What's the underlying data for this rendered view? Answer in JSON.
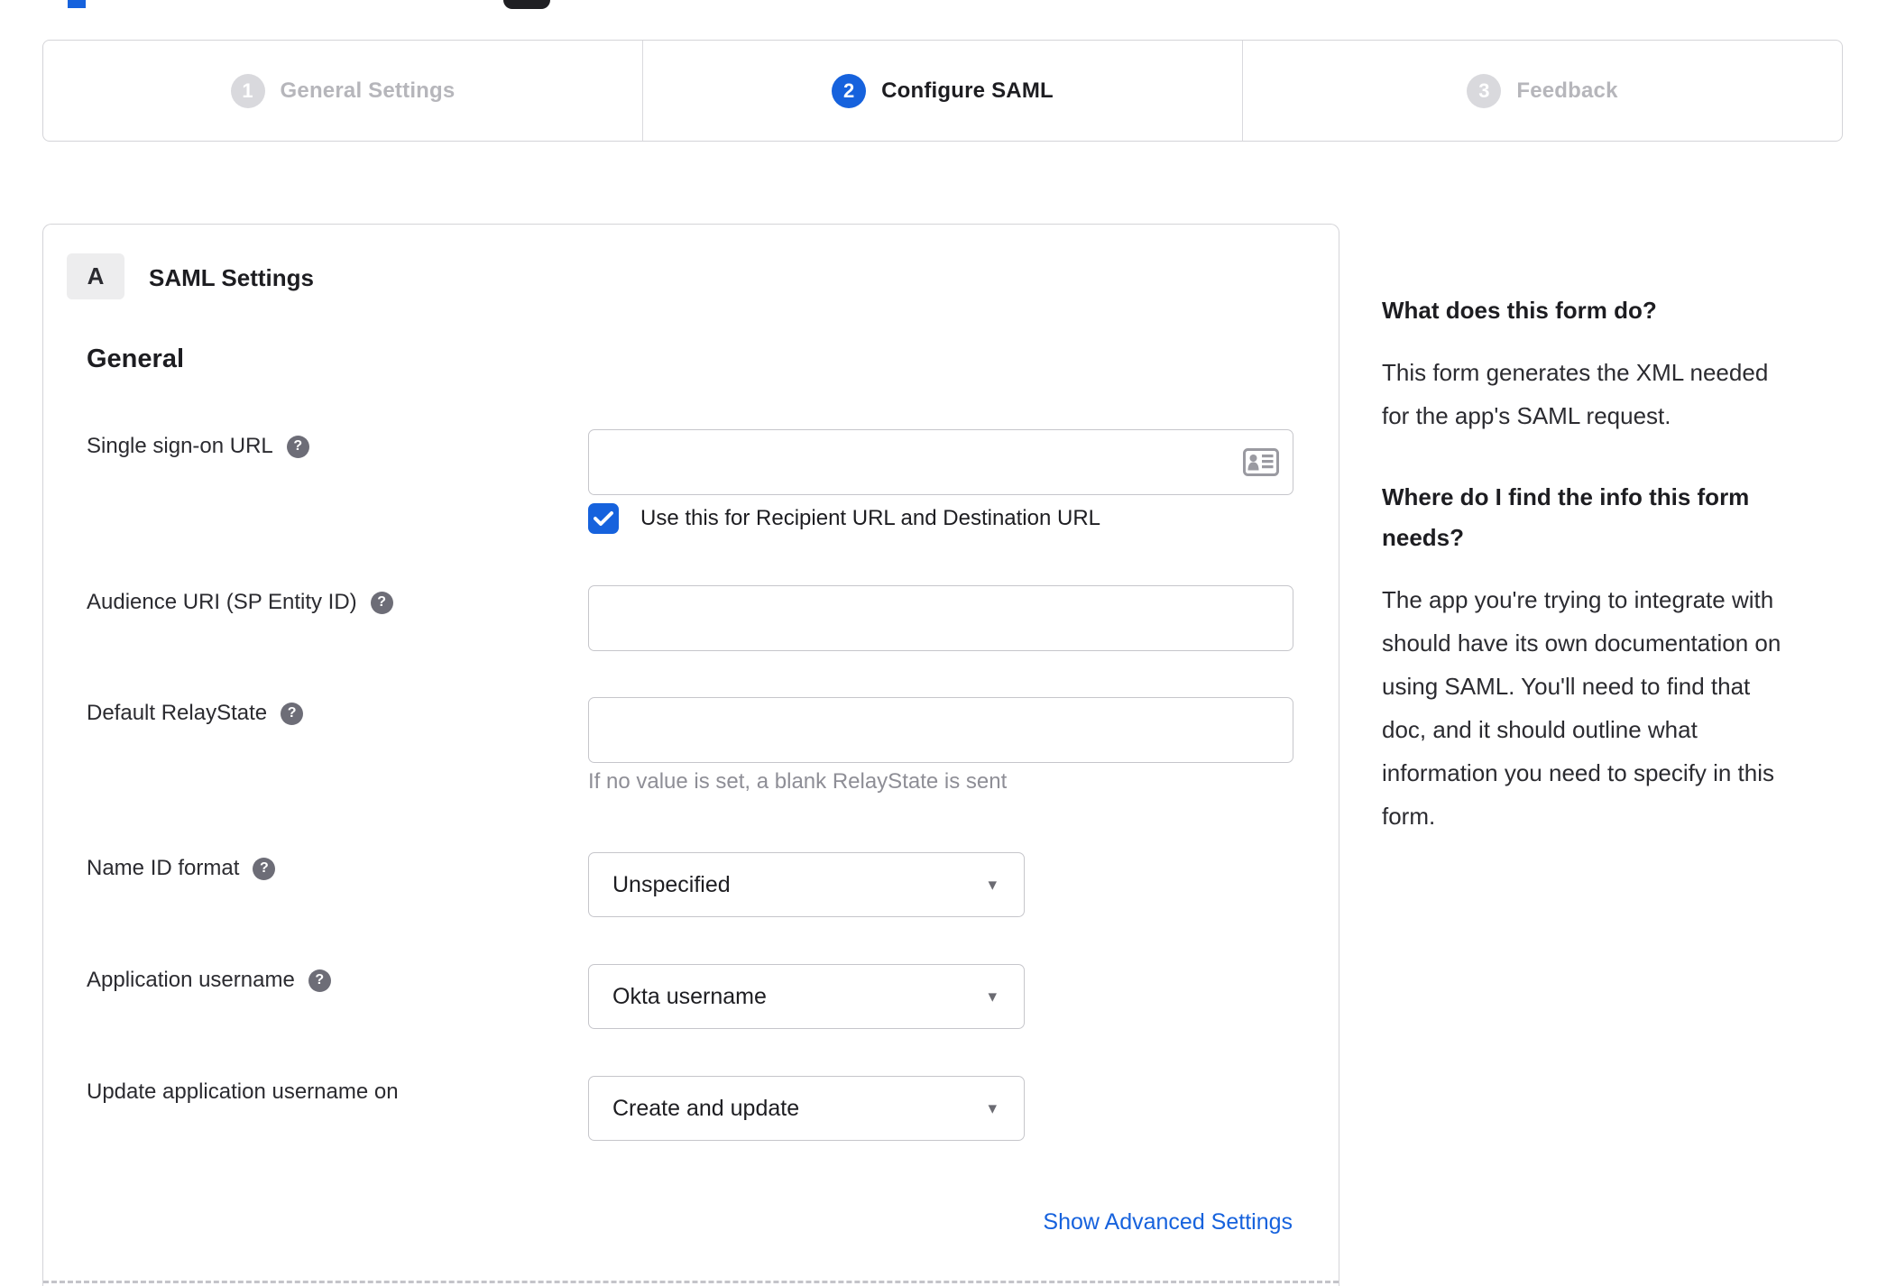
{
  "colors": {
    "accent_blue": "#1662dd",
    "inactive_gray": "#d9d9dd",
    "border_gray": "#d4d4d8"
  },
  "icons": {
    "help": "?",
    "dropdown": "▾",
    "contact_card": "contact-card"
  },
  "stepper": {
    "steps": [
      {
        "number": "1",
        "label": "General Settings",
        "active": false
      },
      {
        "number": "2",
        "label": "Configure SAML",
        "active": true
      },
      {
        "number": "3",
        "label": "Feedback",
        "active": false
      }
    ]
  },
  "panel": {
    "badge": "A",
    "title": "SAML Settings",
    "section": "General",
    "fields": {
      "sso": {
        "label": "Single sign-on URL",
        "value": "",
        "checkbox_label": "Use this for Recipient URL and Destination URL",
        "checked": true
      },
      "audience": {
        "label": "Audience URI (SP Entity ID)",
        "value": ""
      },
      "relay": {
        "label": "Default RelayState",
        "value": "",
        "hint": "If no value is set, a blank RelayState is sent"
      },
      "name_id": {
        "label": "Name ID format",
        "value": "Unspecified"
      },
      "app_username": {
        "label": "Application username",
        "value": "Okta username"
      },
      "update_username": {
        "label": "Update application username on",
        "value": "Create and update"
      }
    },
    "advanced_link": "Show Advanced Settings"
  },
  "sidebar": {
    "q1": "What does this form do?",
    "a1": "This form generates the XML needed\nfor the app's SAML request.",
    "q2": "Where do I find the info this form\nneeds?",
    "a2": "The app you're trying to integrate with\nshould have its own documentation on\nusing SAML. You'll need to find that\ndoc, and it should outline what\ninformation you need to specify in this\nform."
  }
}
